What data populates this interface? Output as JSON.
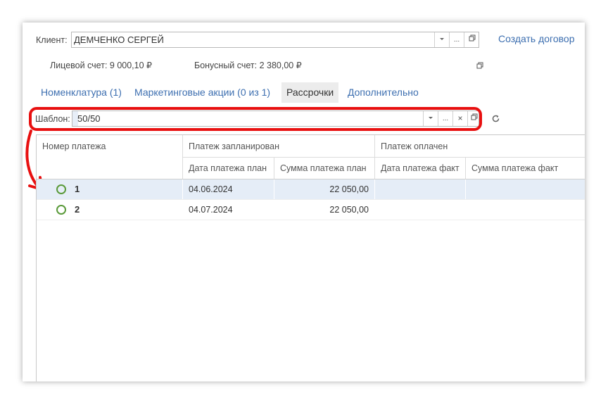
{
  "client": {
    "label": "Клиент:",
    "value": "ДЕМЧЕНКО СЕРГЕЙ",
    "more": "...",
    "create_contract": "Создать договор"
  },
  "accounts": {
    "personal": "Лицевой счет: 9 000,10 ₽",
    "bonus": "Бонусный счет: 2 380,00 ₽"
  },
  "tabs": [
    {
      "label": "Номенклатура (1)"
    },
    {
      "label": "Маркетинговые акции (0 из 1)"
    },
    {
      "label": "Рассрочки"
    },
    {
      "label": "Дополнительно"
    }
  ],
  "template": {
    "label": "Шаблон:",
    "value": "50/50",
    "more": "...",
    "clear": "×"
  },
  "table": {
    "col_number": "Номер платежа",
    "group_planned": "Платеж запланирован",
    "group_paid": "Платеж оплачен",
    "col_plan_date": "Дата платежа план",
    "col_plan_sum": "Сумма платежа план",
    "col_fact_date": "Дата платежа факт",
    "col_fact_sum": "Сумма платежа факт",
    "rows": [
      {
        "number": "1",
        "plan_date": "04.06.2024",
        "plan_sum": "22 050,00",
        "fact_date": "",
        "fact_sum": ""
      },
      {
        "number": "2",
        "plan_date": "04.07.2024",
        "plan_sum": "22 050,00",
        "fact_date": "",
        "fact_sum": ""
      }
    ]
  },
  "colors": {
    "accent": "#3d6fb0",
    "highlight": "#e81010",
    "row_selected": "#e5edf7",
    "status_circle": "#5a9a3a"
  }
}
